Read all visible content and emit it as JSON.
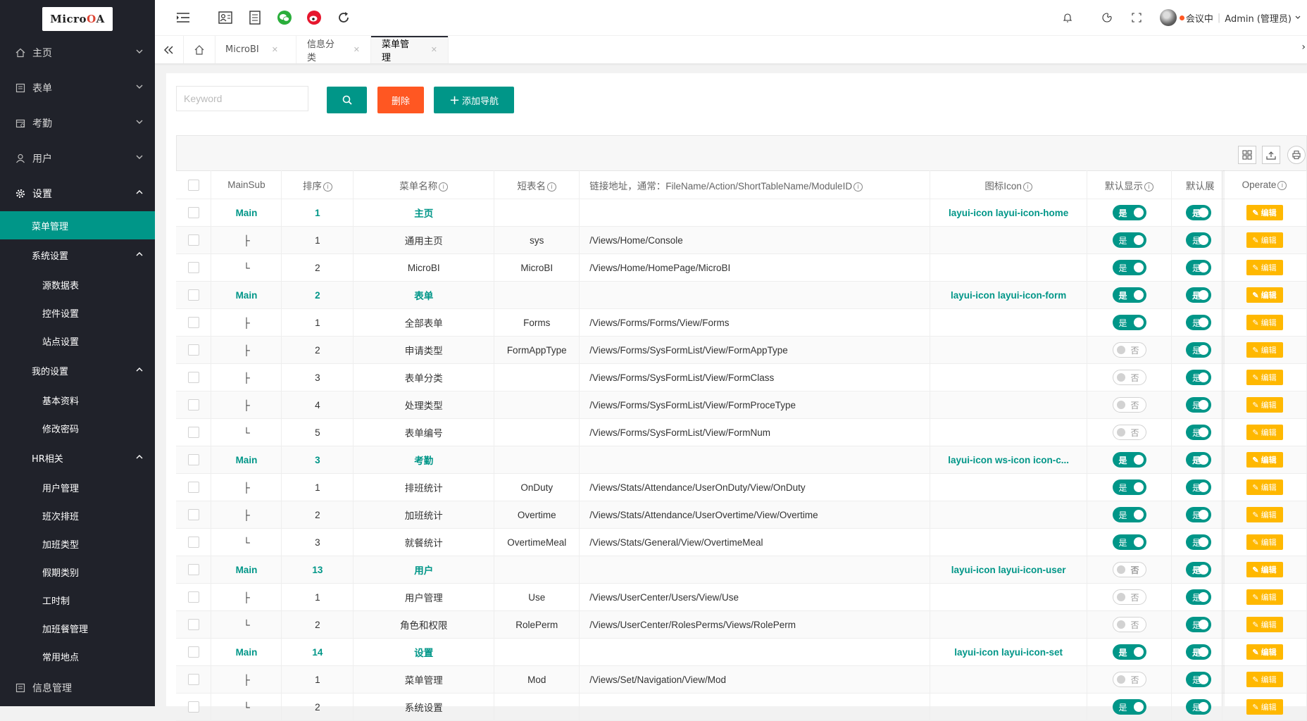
{
  "logo": {
    "text_a": "Micro",
    "text_o": "O",
    "text_b": "A"
  },
  "sidebar": {
    "items": [
      {
        "label": "主页",
        "icon": "home-icon"
      },
      {
        "label": "表单",
        "icon": "form-icon"
      },
      {
        "label": "考勤",
        "icon": "calendar-icon"
      },
      {
        "label": "用户",
        "icon": "user-icon"
      },
      {
        "label": "设置",
        "icon": "gear-icon"
      }
    ],
    "settings_children": {
      "active": "菜单管理",
      "system_group": "系统设置",
      "system_items": [
        "源数据表",
        "控件设置",
        "站点设置"
      ],
      "my_group": "我的设置",
      "my_items": [
        "基本资料",
        "修改密码"
      ],
      "hr_group": "HR相关",
      "hr_items": [
        "用户管理",
        "班次排班",
        "加班类型",
        "假期类别",
        "工时制",
        "加班餐管理",
        "常用地点"
      ]
    },
    "last_item": "信息管理"
  },
  "header": {
    "meeting": "会议中",
    "user": "Admin (管理员)"
  },
  "tabs": [
    {
      "label": "MicroBI"
    },
    {
      "label": "信息分类"
    },
    {
      "label": "菜单管理",
      "active": true
    }
  ],
  "search": {
    "placeholder": "Keyword",
    "delete_label": "删除",
    "add_label": "添加导航"
  },
  "table": {
    "headers": {
      "mainsub": "MainSub",
      "order": "排序",
      "name": "菜单名称",
      "short": "短表名",
      "link": "链接地址，通常：FileName/Action/ShortTableName/ModuleID",
      "icon": "图标Icon",
      "show": "默认显示",
      "expand": "默认展",
      "operate": "Operate"
    },
    "switch_on": "是",
    "switch_off": "否",
    "edit_label": "编辑",
    "rows": [
      {
        "type": "Main",
        "mainsub": "Main",
        "order": "1",
        "name": "主页",
        "short": "",
        "link": "",
        "icon": "layui-icon layui-icon-home",
        "show": true
      },
      {
        "type": "Sub",
        "mainsub": "├",
        "order": "1",
        "name": "通用主页",
        "short": "sys",
        "link": "/Views/Home/Console",
        "icon": "",
        "show": true
      },
      {
        "type": "Sub",
        "mainsub": "└",
        "order": "2",
        "name": "MicroBI",
        "short": "MicroBI",
        "link": "/Views/Home/HomePage/MicroBI",
        "icon": "",
        "show": true
      },
      {
        "type": "Main",
        "mainsub": "Main",
        "order": "2",
        "name": "表单",
        "short": "",
        "link": "",
        "icon": "layui-icon layui-icon-form",
        "show": true
      },
      {
        "type": "Sub",
        "mainsub": "├",
        "order": "1",
        "name": "全部表单",
        "short": "Forms",
        "link": "/Views/Forms/Forms/View/Forms",
        "icon": "",
        "show": true
      },
      {
        "type": "Sub",
        "mainsub": "├",
        "order": "2",
        "name": "申请类型",
        "short": "FormAppType",
        "link": "/Views/Forms/SysFormList/View/FormAppType",
        "icon": "",
        "show": false
      },
      {
        "type": "Sub",
        "mainsub": "├",
        "order": "3",
        "name": "表单分类",
        "short": "",
        "link": "/Views/Forms/SysFormList/View/FormClass",
        "icon": "",
        "show": false
      },
      {
        "type": "Sub",
        "mainsub": "├",
        "order": "4",
        "name": "处理类型",
        "short": "",
        "link": "/Views/Forms/SysFormList/View/FormProceType",
        "icon": "",
        "show": false
      },
      {
        "type": "Sub",
        "mainsub": "└",
        "order": "5",
        "name": "表单编号",
        "short": "",
        "link": "/Views/Forms/SysFormList/View/FormNum",
        "icon": "",
        "show": false
      },
      {
        "type": "Main",
        "mainsub": "Main",
        "order": "3",
        "name": "考勤",
        "short": "",
        "link": "",
        "icon": "layui-icon ws-icon icon-c...",
        "show": true
      },
      {
        "type": "Sub",
        "mainsub": "├",
        "order": "1",
        "name": "排班统计",
        "short": "OnDuty",
        "link": "/Views/Stats/Attendance/UserOnDuty/View/OnDuty",
        "icon": "",
        "show": true
      },
      {
        "type": "Sub",
        "mainsub": "├",
        "order": "2",
        "name": "加班统计",
        "short": "Overtime",
        "link": "/Views/Stats/Attendance/UserOvertime/View/Overtime",
        "icon": "",
        "show": true
      },
      {
        "type": "Sub",
        "mainsub": "└",
        "order": "3",
        "name": "就餐统计",
        "short": "OvertimeMeal",
        "link": "/Views/Stats/General/View/OvertimeMeal",
        "icon": "",
        "show": true
      },
      {
        "type": "Main",
        "mainsub": "Main",
        "order": "13",
        "name": "用户",
        "short": "",
        "link": "",
        "icon": "layui-icon layui-icon-user",
        "show": false
      },
      {
        "type": "Sub",
        "mainsub": "├",
        "order": "1",
        "name": "用户管理",
        "short": "Use",
        "link": "/Views/UserCenter/Users/View/Use",
        "icon": "",
        "show": false
      },
      {
        "type": "Sub",
        "mainsub": "└",
        "order": "2",
        "name": "角色和权限",
        "short": "RolePerm",
        "link": "/Views/UserCenter/RolesPerms/Views/RolePerm",
        "icon": "",
        "show": false
      },
      {
        "type": "Main",
        "mainsub": "Main",
        "order": "14",
        "name": "设置",
        "short": "",
        "link": "",
        "icon": "layui-icon layui-icon-set",
        "show": true
      },
      {
        "type": "Sub",
        "mainsub": "├",
        "order": "1",
        "name": "菜单管理",
        "short": "Mod",
        "link": "/Views/Set/Navigation/View/Mod",
        "icon": "",
        "show": false
      },
      {
        "type": "Sub",
        "mainsub": "└",
        "order": "2",
        "name": "系统设置",
        "short": "",
        "link": "",
        "icon": "",
        "show": true
      }
    ]
  }
}
